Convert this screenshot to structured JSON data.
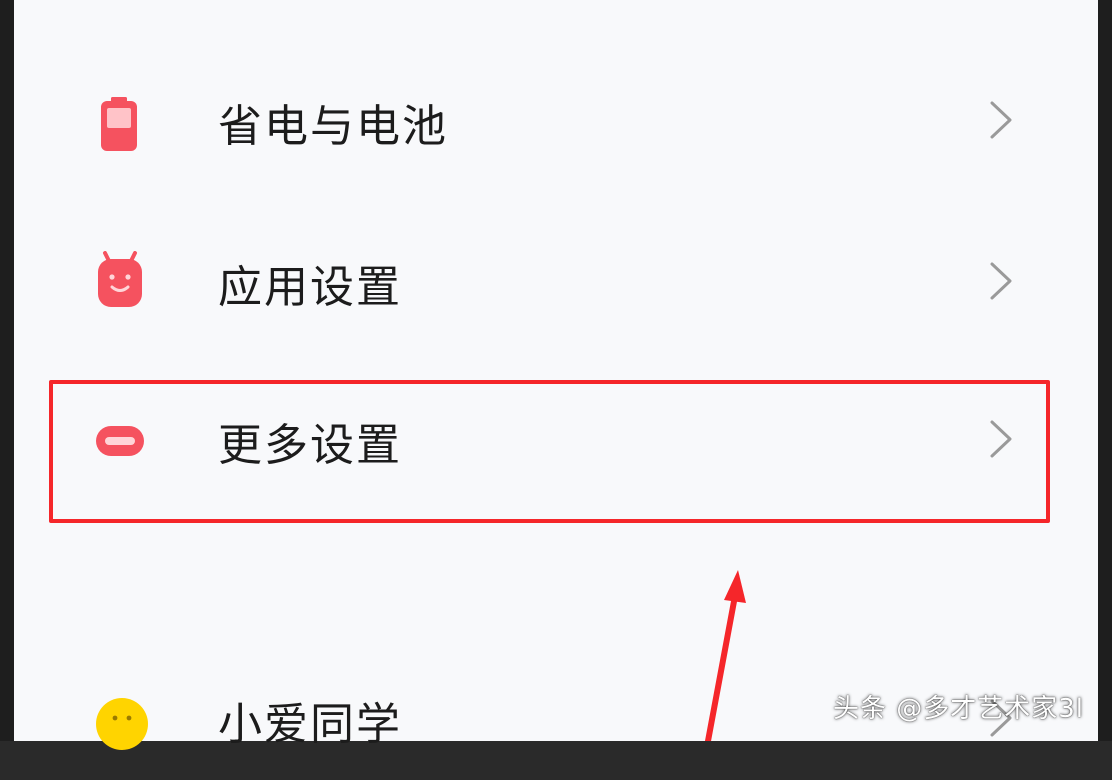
{
  "settings": {
    "items": [
      {
        "label": "省电与电池",
        "icon": "battery-icon",
        "icon_color": "#f5525f"
      },
      {
        "label": "应用设置",
        "icon": "android-app-icon",
        "icon_color": "#f5525f"
      },
      {
        "label": "更多设置",
        "icon": "more-settings-icon",
        "icon_color": "#f5525f"
      },
      {
        "label": "小爱同学",
        "icon": "xiaoai-icon",
        "icon_color": "#ffd400"
      }
    ]
  },
  "annotation": {
    "highlight_color": "#f5262a"
  },
  "watermark": {
    "text": "头条 @多才艺术家3l"
  }
}
